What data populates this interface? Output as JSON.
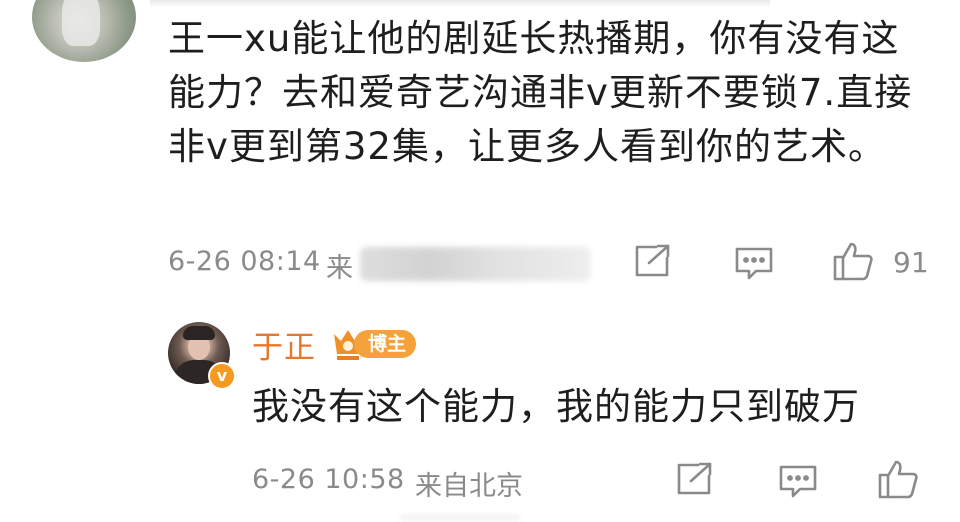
{
  "comment": {
    "text": "王一xu能让他的剧延长热播期，你有没有这能力？去和爱奇艺沟通非v更新不要锁7.直接非v更到第32集，让更多人看到你的艺术。",
    "time": "6-26 08:14",
    "from_label": "来",
    "like_count": "91",
    "icons": {
      "share": "share-icon",
      "comment": "comment-icon",
      "like": "thumbs-up-icon"
    }
  },
  "reply": {
    "author": "于正",
    "badge": "博主",
    "text": "我没有这个能力，我的能力只到破万",
    "time": "6-26 10:58",
    "from": "来自北京",
    "icons": {
      "share": "share-icon",
      "comment": "comment-icon",
      "like": "thumbs-up-icon",
      "crown": "crown-icon",
      "verify": "verified-badge-icon"
    }
  },
  "colors": {
    "author_name": "#e8772e",
    "badge_bg": "#f5a23a",
    "meta_text": "#8a8a8a",
    "body_text": "#1e1e1e"
  }
}
